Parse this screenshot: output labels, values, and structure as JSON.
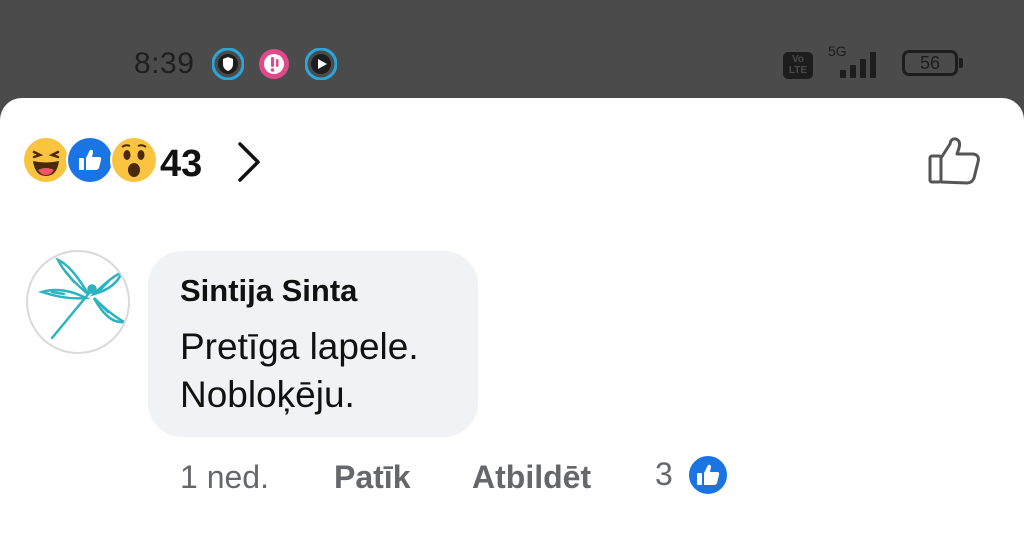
{
  "status_bar": {
    "time": "8:39",
    "network_type": "5G",
    "volte": "Vo LTE",
    "battery": "56",
    "app_icons": [
      "shield-app-icon",
      "notification-app-icon",
      "video-app-icon"
    ]
  },
  "reactions": {
    "emojis": [
      "haha",
      "like",
      "wow"
    ],
    "count": "43",
    "chevron_icon": "chevron-right-icon",
    "like_button_icon": "thumbs-up-outline-icon"
  },
  "comment": {
    "author": "Sintija Sinta",
    "text": "Pretīga lapele.\nNobloķēju.",
    "avatar_icon": "dragonfly-avatar",
    "time": "1 ned.",
    "like_label": "Patīk",
    "reply_label": "Atbildēt",
    "like_count": "3"
  },
  "colors": {
    "facebook_blue": "#1b74e4",
    "status_bar_bg": "#4b4b4b",
    "bubble_bg": "#f0f2f5",
    "meta_text": "#65676b",
    "dragonfly": "#2bb3c0"
  }
}
